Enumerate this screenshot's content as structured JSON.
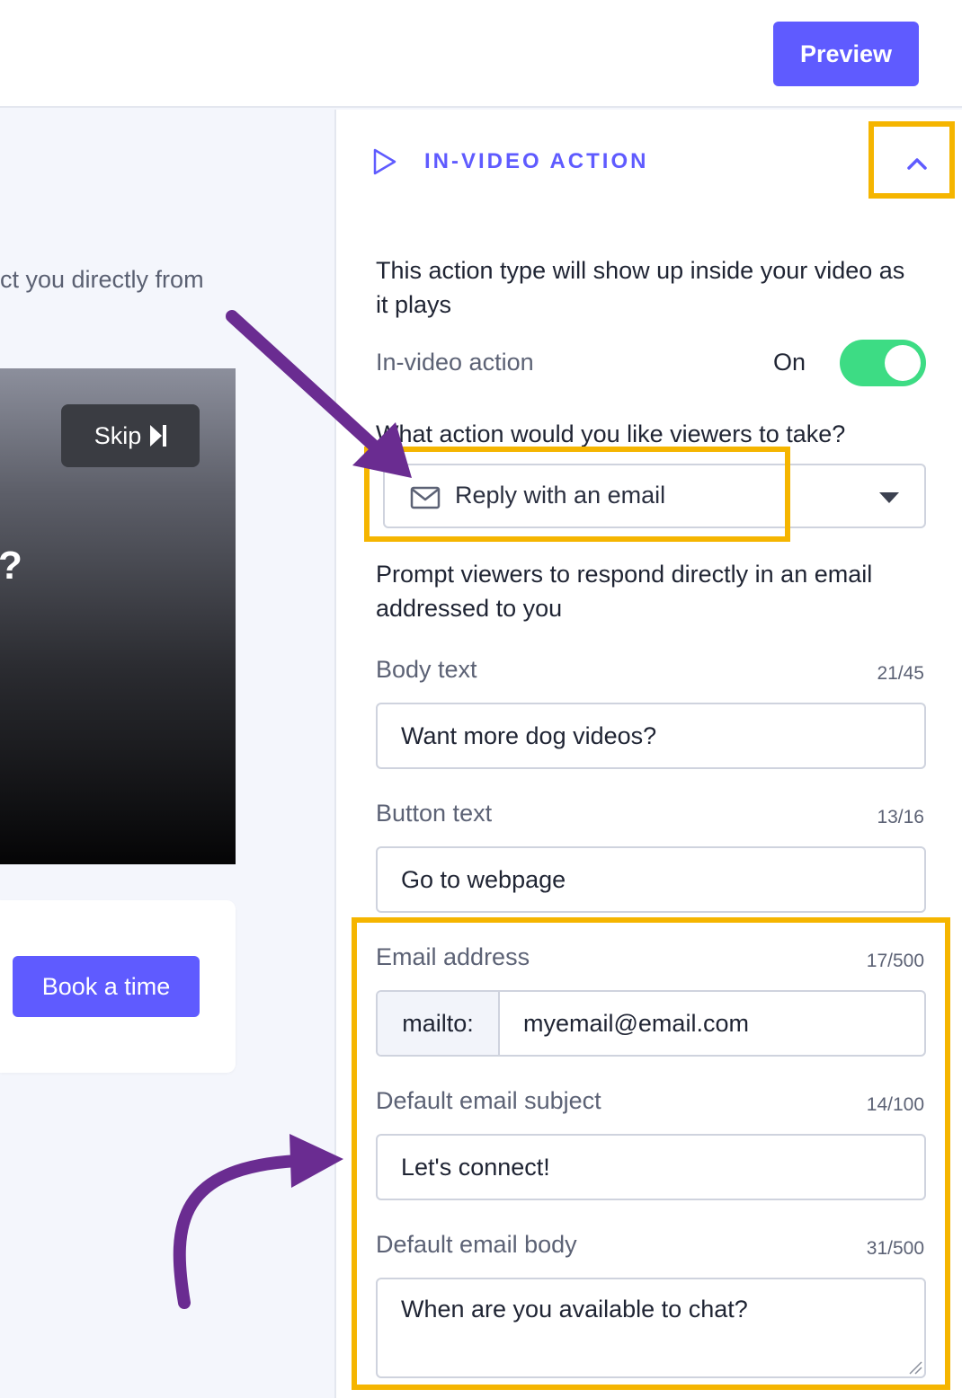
{
  "toolbar": {
    "preview_label": "Preview"
  },
  "left": {
    "description_fragment": "ct you directly from",
    "video_text_fragment": "?",
    "skip_label": "Skip",
    "book_label": "Book a time"
  },
  "panel": {
    "section_title": "IN-VIDEO ACTION",
    "intro_text": "This action type will show up inside your video as it plays",
    "toggle": {
      "label": "In-video action",
      "state_label": "On",
      "on": true
    },
    "action_question": "What action would you like viewers to take?",
    "action_select": {
      "value": "Reply with an email",
      "icon": "envelope-icon"
    },
    "action_help": "Prompt viewers to respond directly in an email addressed to you",
    "body_text": {
      "label": "Body text",
      "count": "21/45",
      "value": "Want more dog videos?"
    },
    "button_text": {
      "label": "Button text",
      "count": "13/16",
      "value": "Go to webpage"
    },
    "email_address": {
      "label": "Email address",
      "count": "17/500",
      "prefix": "mailto:",
      "value": "myemail@email.com"
    },
    "email_subject": {
      "label": "Default email subject",
      "count": "14/100",
      "value": "Let's connect!"
    },
    "email_body": {
      "label": "Default email body",
      "count": "31/500",
      "value": "When are you available to chat?"
    }
  },
  "colors": {
    "accent": "#5f5bff",
    "toggle_on": "#3ddc84",
    "highlight": "#f5b500",
    "arrow": "#6a2c91"
  }
}
